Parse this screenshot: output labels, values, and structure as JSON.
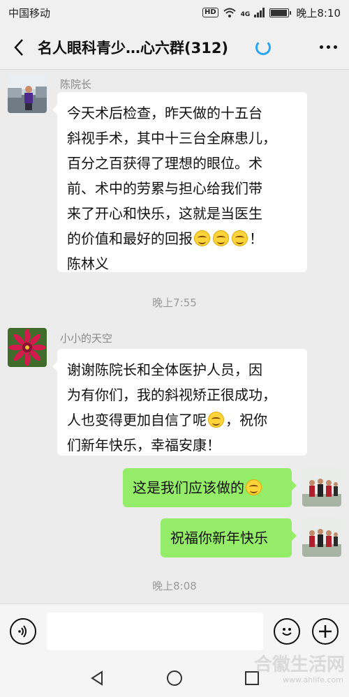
{
  "status_bar": {
    "carrier": "中国移动",
    "network_badge": "HD",
    "signal_label": "4G",
    "time": "晚上8:10",
    "battery_level": 0.95
  },
  "header": {
    "title": "名人眼科青少…心六群(312)",
    "icons": [
      "back-chevron-icon",
      "loading-spinner-icon",
      "more-dots-icon"
    ]
  },
  "messages": [
    {
      "sender": "陈院长",
      "lines": [
        "今天术后检查，昨天做的十五台",
        "斜视手术，其中十三台全麻患儿，",
        "百分之百获得了理想的眼位。术",
        "前、术中的劳累与担心给我们带",
        "来了开心和快乐，这就是当医生",
        "的价值和最好的回报",
        "！",
        "陈林义"
      ]
    },
    {
      "timestamp": "晚上7:55"
    },
    {
      "sender": "小小的天空",
      "lines": [
        "谢谢陈院长和全体医护人员，因",
        "为有你们，我的斜视矫正很成功，",
        "人也变得更加自信了呢",
        "，祝你",
        "们新年快乐，幸福安康！"
      ]
    },
    {
      "me_1": "这是我们应该做的"
    },
    {
      "me_2": "祝福你新年快乐"
    },
    {
      "timestamp": "晚上8:08"
    }
  ],
  "input_bar": {
    "icons": [
      "voice-icon",
      "emoji-icon",
      "add-icon"
    ],
    "text_value": ""
  },
  "system_nav": {
    "icons": [
      "back-triangle-icon",
      "home-circle-icon",
      "recents-square-icon"
    ]
  },
  "watermark": {
    "brand": "合徽生活网",
    "url": "www.ahlife.com"
  },
  "colors": {
    "my_bubble": "#95ec69",
    "other_bubble": "#ffffff",
    "chat_background": "#ececec",
    "spinner": "#2aa4f4"
  }
}
